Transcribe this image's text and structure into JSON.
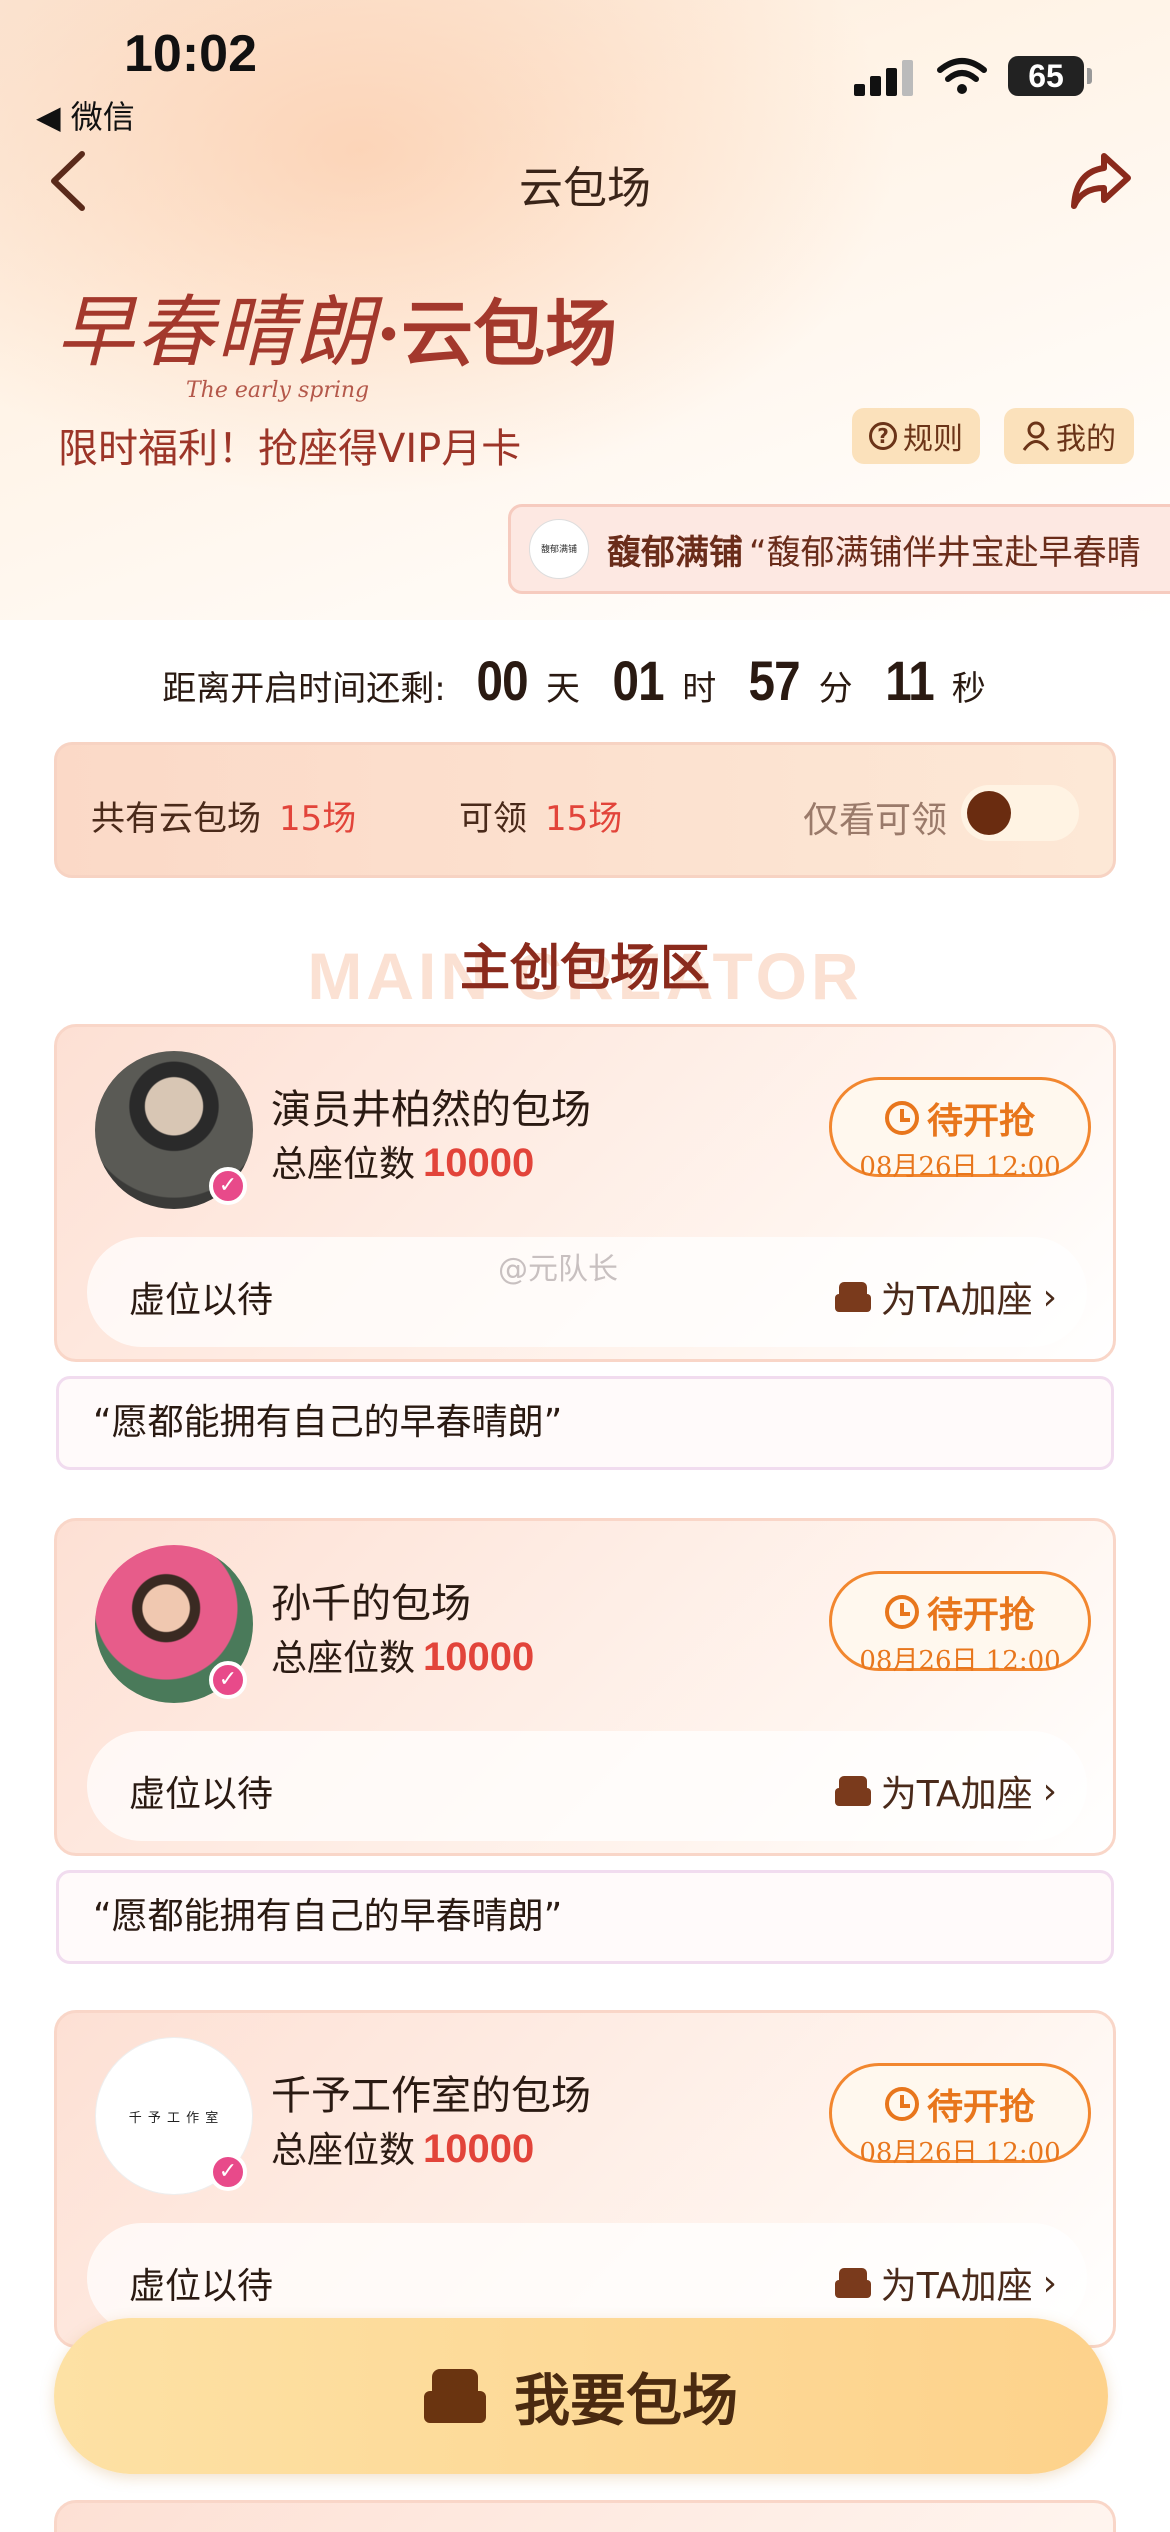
{
  "status": {
    "time": "10:02",
    "back_app": "◀ 微信",
    "battery": "65"
  },
  "nav": {
    "title": "云包场"
  },
  "banner": {
    "title_script": "早春晴朗",
    "title_main": "·云包场",
    "subtitle_en": "The early spring",
    "slogan": "限时福利！抢座得VIP月卡",
    "rules_label": "规则",
    "mine_label": "我的"
  },
  "ticker": {
    "logo_text": "馥郁满铺",
    "name": "馥郁满铺",
    "text": "“馥郁满铺伴井宝赴早春晴"
  },
  "countdown": {
    "label": "距离开启时间还剩:",
    "days": "00",
    "days_unit": "天",
    "hours": "01",
    "hours_unit": "时",
    "minutes": "57",
    "minutes_unit": "分",
    "seconds": "11",
    "seconds_unit": "秒"
  },
  "summary": {
    "total_label": "共有云包场",
    "total_value": "15场",
    "claim_label": "可领",
    "claim_value": "15场",
    "filter_label": "仅看可领"
  },
  "section": {
    "title": "主创包场区",
    "bg_text": "MAIN CREATOR"
  },
  "cards": [
    {
      "title": "演员井柏然的包场",
      "seats_label": "总座位数",
      "seats": "10000",
      "button": "待开抢",
      "date": "08月26日 12:00",
      "row_left": "虚位以待",
      "row_right": "为TA加座",
      "quote": "“愿都能拥有自己的早春晴朗”"
    },
    {
      "title": "孙千的包场",
      "seats_label": "总座位数",
      "seats": "10000",
      "button": "待开抢",
      "date": "08月26日 12:00",
      "row_left": "虚位以待",
      "row_right": "为TA加座",
      "quote": "“愿都能拥有自己的早春晴朗”"
    },
    {
      "title": "千予工作室的包场",
      "avatar_text": "千 予 工 作 室",
      "seats_label": "总座位数",
      "seats": "10000",
      "button": "待开抢",
      "date": "08月26日 12:00",
      "row_left": "虚位以待",
      "row_right": "为TA加座"
    }
  ],
  "watermark": "@元队长",
  "cta": {
    "label": "我要包场"
  },
  "colors": {
    "accent_orange": "#e8761c",
    "accent_red": "#e2443a",
    "brand_brown": "#6a2c10"
  }
}
